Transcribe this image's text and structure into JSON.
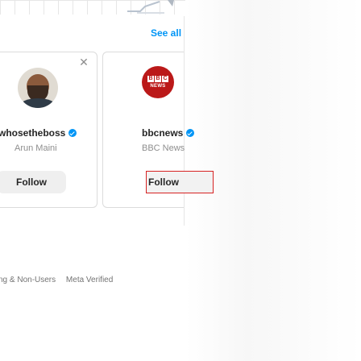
{
  "suggestions": {
    "see_all": "See all",
    "cards": [
      {
        "handle": "whosetheboss",
        "name": "Arun Maini",
        "button": "Follow",
        "verified": true
      },
      {
        "handle": "bbcnews",
        "name": "BBC News",
        "button": "Follow",
        "verified": true
      }
    ]
  },
  "footer": {
    "links": [
      "ng & Non-Users",
      "Meta Verified"
    ]
  },
  "colors": {
    "link": "#0095f6",
    "bbc_red": "#bb1919"
  }
}
